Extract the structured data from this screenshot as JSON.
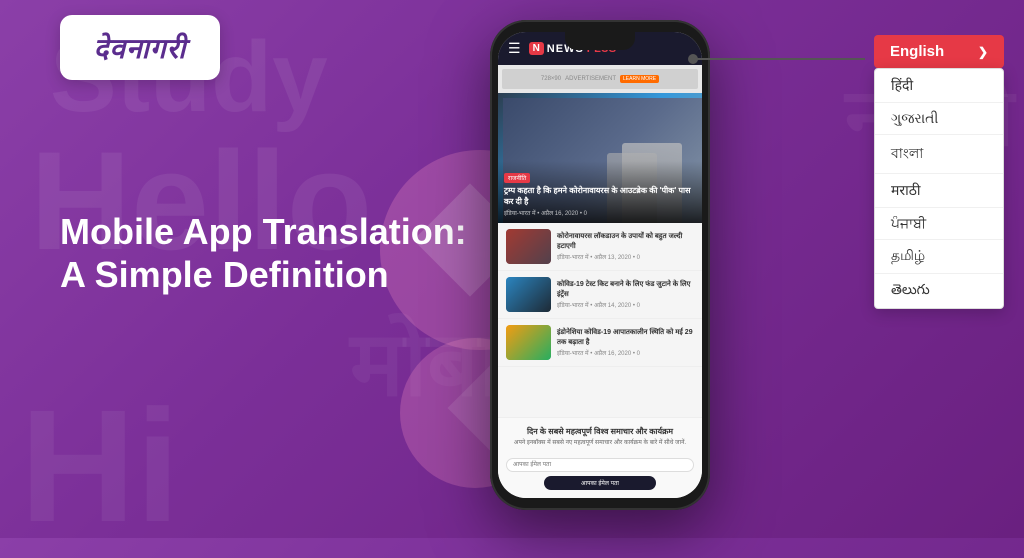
{
  "logo": {
    "text": "देवनागरी",
    "alt": "Devnagri logo"
  },
  "background": {
    "text1": "Hello",
    "text2": "Study",
    "text3": "नमस्ते",
    "text4": "Hi"
  },
  "main_title": {
    "line1": "Mobile App Translation:",
    "line2": "A Simple Definition"
  },
  "phone": {
    "app_name": "NEWSPLUS",
    "app_logo_n": "N",
    "ad_size": "728×90",
    "ad_label": "ADVERTISEMENT",
    "ad_btn": "LEARN MORE",
    "main_news": {
      "tag": "राजनीति",
      "title": "ट्रम्प कहता है कि हमने\nकोरोनावायरस के आउटब्रेक की\n'पीक' पास कर दी है",
      "meta": "इंडिया-भारत में • अप्रैल 16, 2020 • 0"
    },
    "news_items": [
      {
        "title": "कोरोनावायरस लॉकडाउन के उपायों को बहुत जल्दी हटाएगी",
        "meta": "इंडिया-भारत में • अप्रैल 13, 2020 • 0"
      },
      {
        "title": "कोविड-19 टेस्ट किट बनाने के लिए फंड जुटाने के लिए इंट्रेंस",
        "meta": "इंडिया-भारत में • अप्रैल 14, 2020 • 0"
      },
      {
        "title": "इंडोनेशिया कोविड-19 आपातकालीन स्थिति को मई 29 तक बढ़ाता है",
        "meta": "इंडिया-भारत में • अप्रैल 16, 2020 • 0"
      }
    ],
    "newsletter": {
      "title": "दिन के सबसे महत्वपूर्ण विश्व समाचार और कार्यक्रम",
      "desc": "अपने इनबॉक्स में सबसे नए महत्वपूर्ण समाचार और कार्यक्रम\nके बारे में सीधे जानें.",
      "input_placeholder": "आपका ईमेल पता",
      "btn_label": "आपका ईमेल पता"
    }
  },
  "dropdown": {
    "selected": "English",
    "arrow": "❯",
    "options": [
      "हिंदी",
      "ગુજરાતી",
      "বাংলা",
      "मराठी",
      "ਪੰਜਾਬੀ",
      "தமிழ்",
      "తెలుగు"
    ]
  }
}
